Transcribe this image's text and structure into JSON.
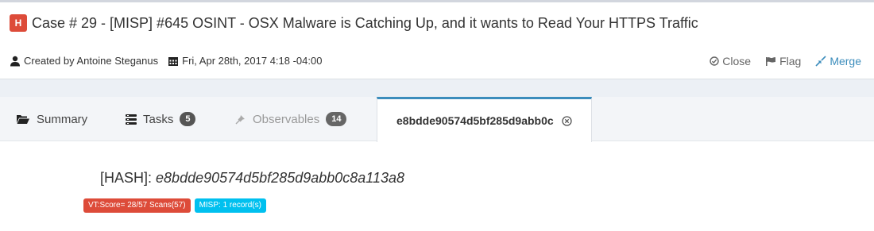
{
  "case": {
    "severity": "H",
    "title": "Case # 29 - [MISP] #645 OSINT - OSX Malware is Catching Up, and it wants to Read Your HTTPS Traffic",
    "created_by": "Created by Antoine Steganus",
    "date": "Fri, Apr 28th, 2017 4:18 -04:00"
  },
  "actions": {
    "close": "Close",
    "flag": "Flag",
    "merge": "Merge"
  },
  "tabs": [
    {
      "label": "Summary",
      "icon": "folder-open-icon"
    },
    {
      "label": "Tasks",
      "count": "5",
      "icon": "tasks-icon"
    },
    {
      "label": "Observables",
      "count": "14",
      "icon": "pin-icon"
    },
    {
      "label": "e8bdde90574d5bf285d9abb0c",
      "icon": "close-circle-icon"
    }
  ],
  "observable": {
    "type_label": "[HASH]:",
    "value": "e8bdde90574d5bf285d9abb0c8a113a8",
    "badges": {
      "vt": "VT:Score= 28/57 Scans(57)",
      "misp": "MISP: 1 record(s)"
    }
  },
  "colors": {
    "severity_high": "#dd4b39",
    "link_blue": "#3c8dbc",
    "misp_badge": "#00c0ef"
  }
}
